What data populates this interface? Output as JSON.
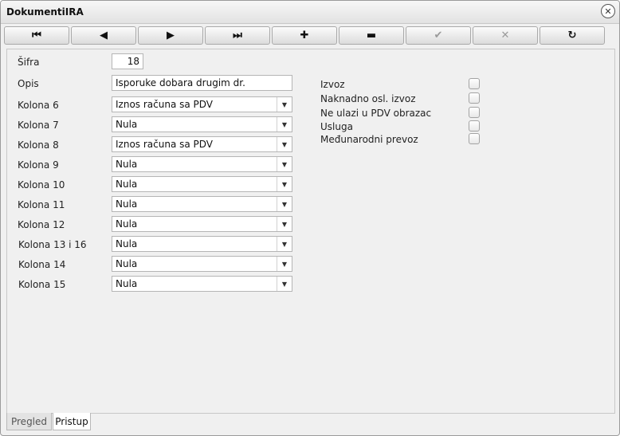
{
  "window": {
    "title": "DokumentiIRA",
    "close_glyph": "✕"
  },
  "toolbar": {
    "buttons": [
      {
        "icon": "first-record-icon",
        "glyph": "⏮"
      },
      {
        "icon": "previous-record-icon",
        "glyph": "◀"
      },
      {
        "icon": "next-record-icon",
        "glyph": "▶"
      },
      {
        "icon": "last-record-icon",
        "glyph": "⏭"
      },
      {
        "icon": "add-icon",
        "glyph": "✚"
      },
      {
        "icon": "remove-icon",
        "glyph": "▬"
      },
      {
        "icon": "confirm-icon",
        "glyph": "✔"
      },
      {
        "icon": "cancel-icon",
        "glyph": "✕"
      },
      {
        "icon": "refresh-icon",
        "glyph": "↻"
      }
    ]
  },
  "form": {
    "sifra_label": "Šifra",
    "sifra_value": "18",
    "opis_label": "Opis",
    "opis_value": "Isporuke dobara drugim dr.",
    "columns": [
      {
        "label": "Kolona 6",
        "value": "Iznos računa sa PDV"
      },
      {
        "label": "Kolona 7",
        "value": "Nula"
      },
      {
        "label": "Kolona 8",
        "value": "Iznos računa sa PDV"
      },
      {
        "label": "Kolona 9",
        "value": "Nula"
      },
      {
        "label": "Kolona 10",
        "value": "Nula"
      },
      {
        "label": "Kolona 11",
        "value": "Nula"
      },
      {
        "label": "Kolona 12",
        "value": "Nula"
      },
      {
        "label": "Kolona 13 i 16",
        "value": "Nula"
      },
      {
        "label": "Kolona 14",
        "value": "Nula"
      },
      {
        "label": "Kolona 15",
        "value": "Nula"
      }
    ],
    "flags": [
      {
        "label": "Izvoz",
        "checked": false
      },
      {
        "label": "Naknadno osl. izvoz",
        "checked": false
      },
      {
        "label": "Ne ulazi u PDV obrazac",
        "checked": false
      },
      {
        "label": "Usluga",
        "checked": false
      },
      {
        "label": "Međunarodni prevoz",
        "checked": false
      }
    ]
  },
  "tabs": [
    {
      "label": "Pregled",
      "active": false
    },
    {
      "label": "Pristup",
      "active": true
    }
  ]
}
